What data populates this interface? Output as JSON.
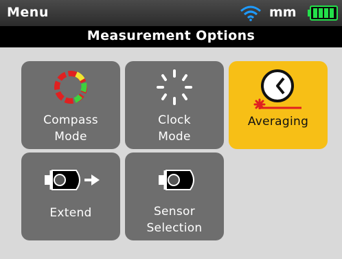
{
  "status_bar": {
    "title": "Menu",
    "unit": "mm",
    "wifi_icon": "wifi-icon",
    "battery_icon": "battery-icon",
    "wifi_color": "#1e9bff",
    "battery_color": "#23e04a"
  },
  "header": {
    "title": "Measurement Options"
  },
  "tiles": [
    {
      "label_line1": "Compass",
      "label_line2": "Mode",
      "icon": "compass-mode-icon",
      "selected": false
    },
    {
      "label_line1": "Clock",
      "label_line2": "Mode",
      "icon": "clock-mode-icon",
      "selected": false
    },
    {
      "label": "Averaging",
      "icon": "averaging-icon",
      "selected": true
    },
    {
      "label": "Extend",
      "icon": "extend-icon",
      "selected": false
    },
    {
      "label_line1": "Sensor",
      "label_line2": "Selection",
      "icon": "sensor-selection-icon",
      "selected": false
    }
  ],
  "colors": {
    "background": "#d9d9d9",
    "tile": "#6e6e6e",
    "tile_selected": "#f7bf16",
    "red": "#e02020",
    "green": "#3ed13e",
    "yellow": "#f2e630"
  }
}
